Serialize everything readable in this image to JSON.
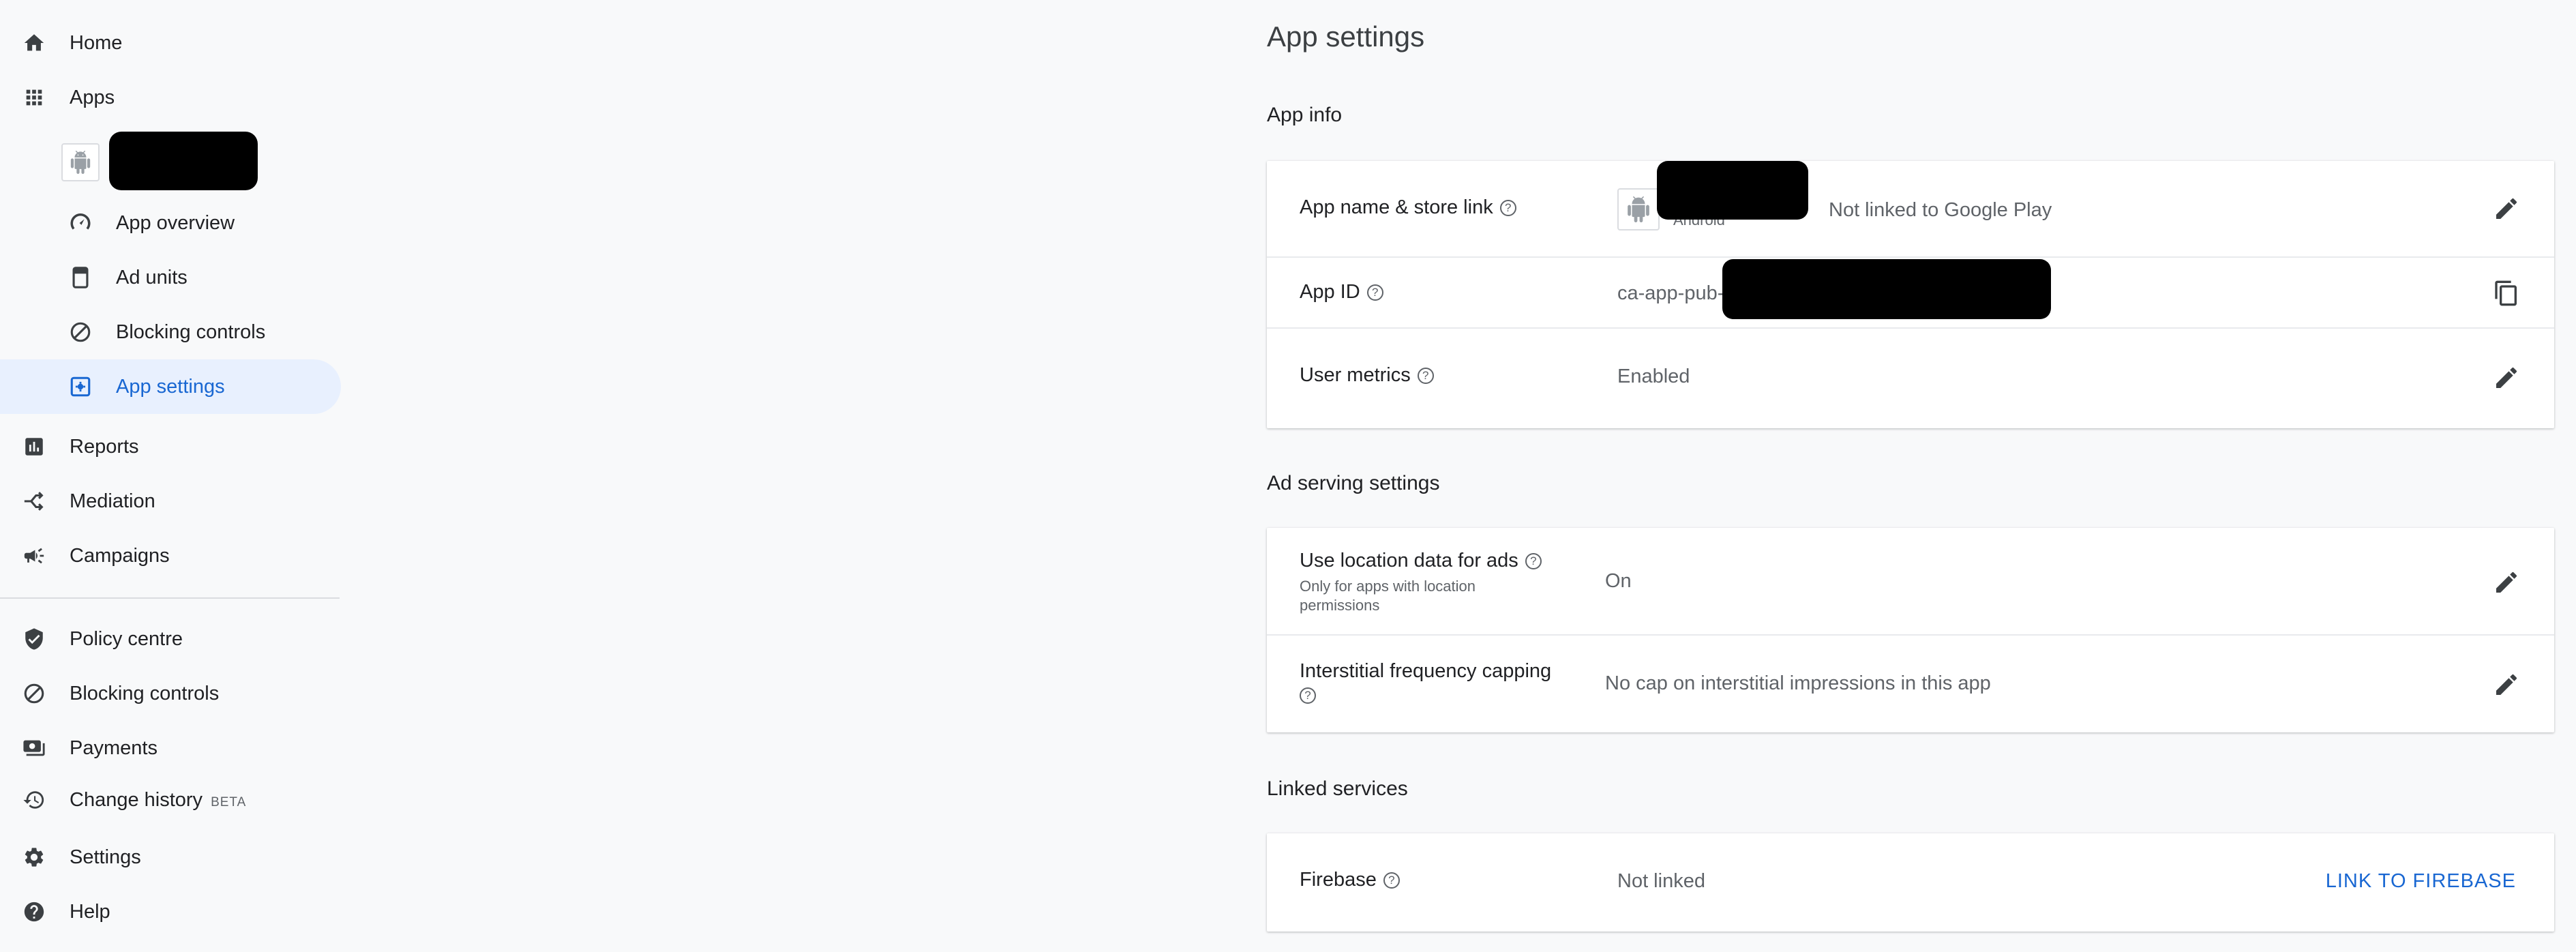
{
  "sidebar": {
    "home": {
      "label": "Home",
      "icon": "home-icon"
    },
    "apps": {
      "label": "Apps",
      "icon": "apps-grid-icon"
    },
    "app_sub": [
      {
        "label": "App overview",
        "icon": "speedometer-icon"
      },
      {
        "label": "Ad units",
        "icon": "ad-unit-icon"
      },
      {
        "label": "Blocking controls",
        "icon": "block-icon"
      },
      {
        "label": "App settings",
        "icon": "app-settings-icon",
        "active": true
      }
    ],
    "reports": {
      "label": "Reports",
      "icon": "bar-chart-icon"
    },
    "mediation": {
      "label": "Mediation",
      "icon": "mediation-icon"
    },
    "campaigns": {
      "label": "Campaigns",
      "icon": "megaphone-icon"
    },
    "policy": {
      "label": "Policy centre",
      "icon": "shield-icon"
    },
    "blocking": {
      "label": "Blocking controls",
      "icon": "block-icon"
    },
    "payments": {
      "label": "Payments",
      "icon": "payments-icon"
    },
    "history": {
      "label": "Change history",
      "badge": "BETA",
      "icon": "history-icon"
    },
    "settings": {
      "label": "Settings",
      "icon": "gear-icon"
    },
    "help": {
      "label": "Help",
      "icon": "help-icon"
    }
  },
  "main": {
    "title": "App settings",
    "app_info": {
      "title": "App info",
      "name_store": {
        "label": "App name & store link",
        "platform": "Android",
        "value": "Not linked to Google Play"
      },
      "app_id": {
        "label": "App ID",
        "value_prefix": "ca-app-pub-"
      },
      "user_metrics": {
        "label": "User metrics",
        "value": "Enabled"
      }
    },
    "ad_serving": {
      "title": "Ad serving settings",
      "location": {
        "label": "Use location data for ads",
        "sublabel": "Only for apps with location permissions",
        "value": "On"
      },
      "frequency": {
        "label": "Interstitial frequency capping",
        "value": "No cap on interstitial impressions in this app"
      }
    },
    "linked": {
      "title": "Linked services",
      "firebase": {
        "label": "Firebase",
        "value": "Not linked",
        "action": "LINK TO FIREBASE"
      }
    }
  },
  "colors": {
    "accent": "#1967d2",
    "active_bg": "#e8f0fe",
    "text": "#202124",
    "muted": "#5f6368"
  }
}
